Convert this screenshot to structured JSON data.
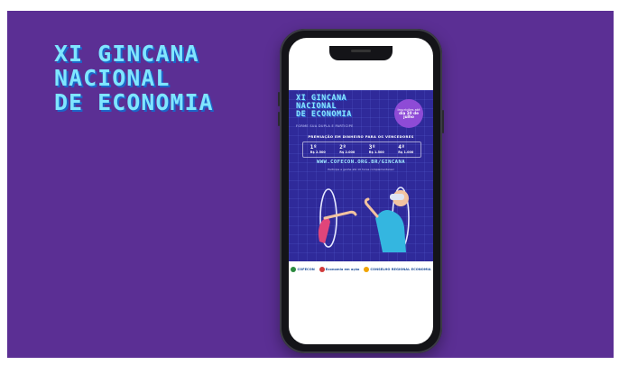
{
  "headline": {
    "lines": [
      "XI GINCANA",
      "NACIONAL",
      "DE ECONOMIA"
    ]
  },
  "poster": {
    "title_lines": [
      "XI GINCANA",
      "NACIONAL",
      "DE ECONOMIA"
    ],
    "subtitle": "FORME SUA DUPLA E PARTICIPE",
    "badge_line1": "Inscrições até",
    "badge_line2": "dia 30 de julho",
    "prize_heading": "PREMIAÇÃO EM DINHEIRO PARA OS VENCEDORES",
    "prizes": [
      {
        "place": "1º",
        "amount": "R$ 2.500"
      },
      {
        "place": "2º",
        "amount": "R$ 2.000"
      },
      {
        "place": "3º",
        "amount": "R$ 1.500"
      },
      {
        "place": "4º",
        "amount": "R$ 1.000"
      }
    ],
    "url": "WWW.COFECON.ORG.BR/GINCANA",
    "note": "Participe e ganhe até 10 horas complementares!",
    "logos": [
      "COFECON",
      "Economia em ação",
      "CONSELHO REGIONAL ECONOMIA"
    ]
  },
  "colors": {
    "background": "#5b2f94",
    "headline": "#7fe6ff",
    "headline_shadow": "#1c66c8",
    "poster_bg": "#2f2a9a",
    "badge": "#8e4bd6"
  }
}
